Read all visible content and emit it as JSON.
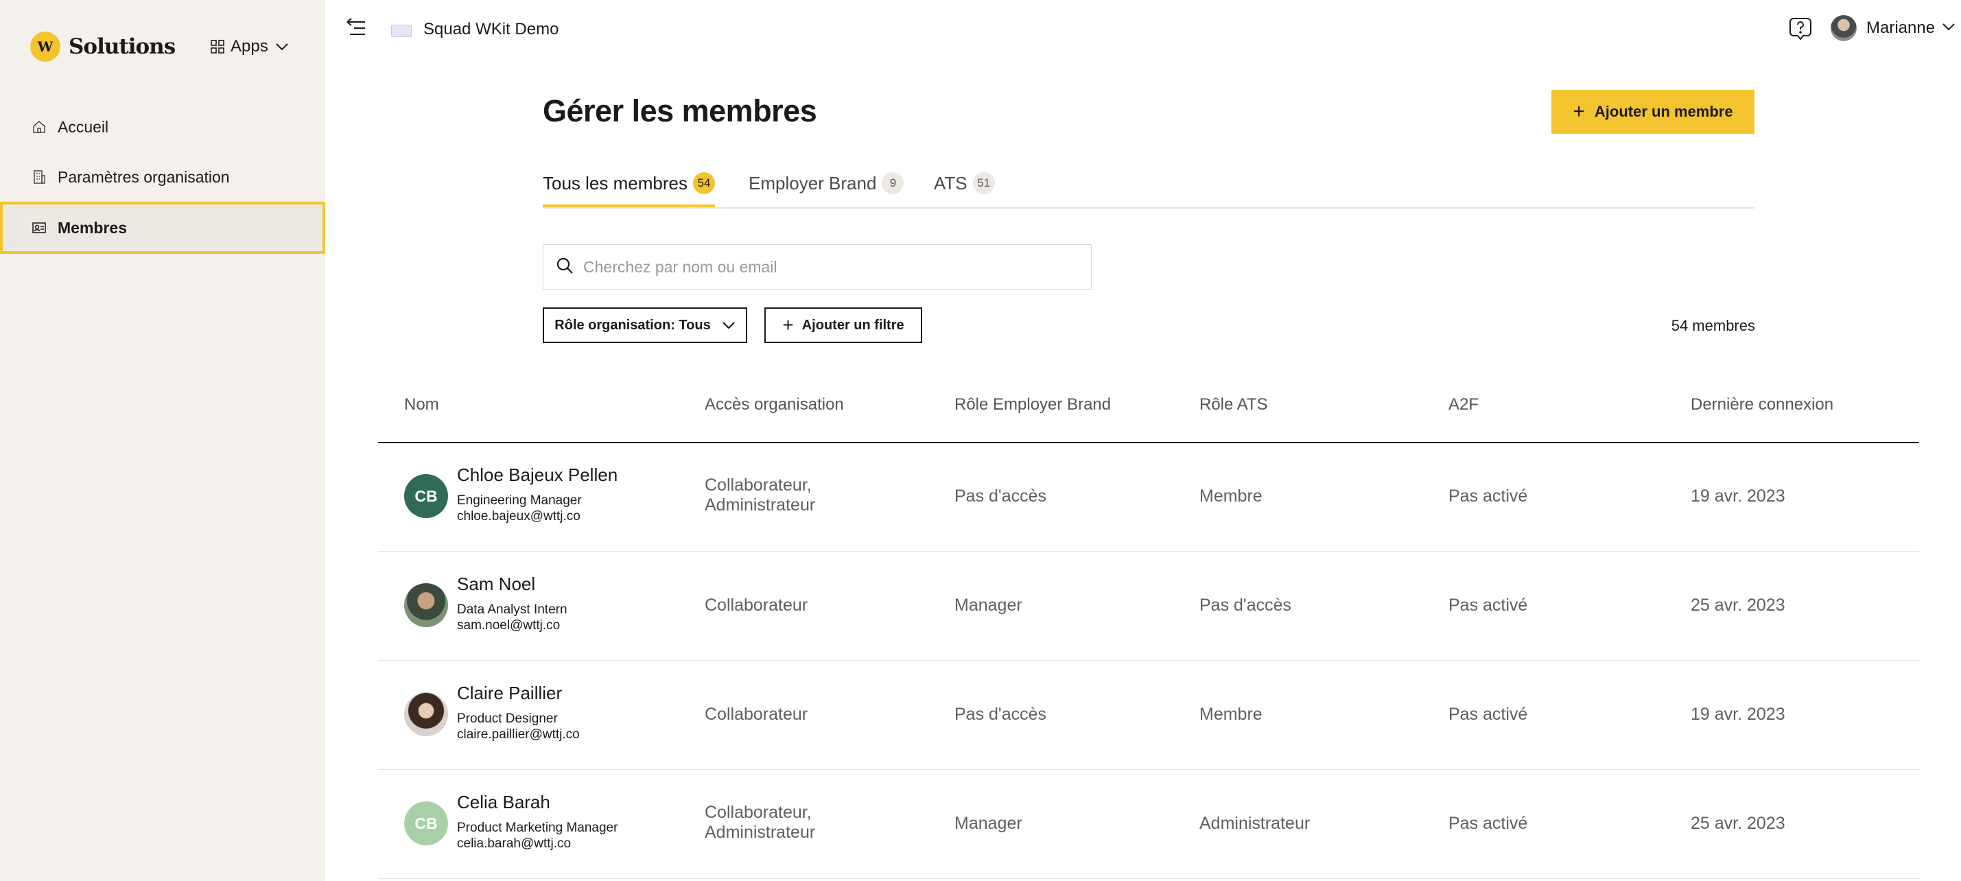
{
  "brand": {
    "name": "Solutions",
    "mark": "W"
  },
  "apps_label": "Apps",
  "sidebar": {
    "items": [
      {
        "label": "Accueil"
      },
      {
        "label": "Paramètres organisation"
      },
      {
        "label": "Membres"
      }
    ]
  },
  "header": {
    "org_name": "Squad WKit Demo",
    "user_name": "Marianne"
  },
  "page": {
    "title": "Gérer les membres",
    "add_button": "Ajouter un membre"
  },
  "tabs": [
    {
      "label": "Tous les membres",
      "count": "54"
    },
    {
      "label": "Employer Brand",
      "count": "9"
    },
    {
      "label": "ATS",
      "count": "51"
    }
  ],
  "search": {
    "placeholder": "Cherchez par nom ou email"
  },
  "filters": {
    "role_filter": "Rôle organisation: Tous",
    "add_filter": "Ajouter un filtre"
  },
  "members_count": "54 membres",
  "table": {
    "columns": [
      "Nom",
      "Accès organisation",
      "Rôle Employer Brand",
      "Rôle ATS",
      "A2F",
      "Dernière connexion"
    ],
    "rows": [
      {
        "initials": "CB",
        "avatar_color": "#2f6b55",
        "name": "Chloe Bajeux Pellen",
        "title": "Engineering Manager",
        "email": "chloe.bajeux@wttj.co",
        "access_1": "Collaborateur,",
        "access_2": "Administrateur",
        "eb_role": "Pas d'accès",
        "ats_role": "Membre",
        "a2f": "Pas activé",
        "last_login": "19 avr. 2023"
      },
      {
        "initials": "",
        "avatar_color": "",
        "name": "Sam Noel",
        "title": "Data Analyst Intern",
        "email": "sam.noel@wttj.co",
        "access_1": "Collaborateur",
        "access_2": "",
        "eb_role": "Manager",
        "ats_role": "Pas d'accès",
        "a2f": "Pas activé",
        "last_login": "25 avr. 2023"
      },
      {
        "initials": "",
        "avatar_color": "",
        "name": "Claire Paillier",
        "title": "Product Designer",
        "email": "claire.paillier@wttj.co",
        "access_1": "Collaborateur",
        "access_2": "",
        "eb_role": "Pas d'accès",
        "ats_role": "Membre",
        "a2f": "Pas activé",
        "last_login": "19 avr. 2023"
      },
      {
        "initials": "CB",
        "avatar_color": "#a8d0a8",
        "name": "Celia Barah",
        "title": "Product Marketing Manager",
        "email": "celia.barah@wttj.co",
        "access_1": "Collaborateur,",
        "access_2": "Administrateur",
        "eb_role": "Manager",
        "ats_role": "Administrateur",
        "a2f": "Pas activé",
        "last_login": "25 avr. 2023"
      }
    ]
  },
  "colors": {
    "accent": "#f4c430",
    "sidebar_bg": "#f4f1ec"
  }
}
